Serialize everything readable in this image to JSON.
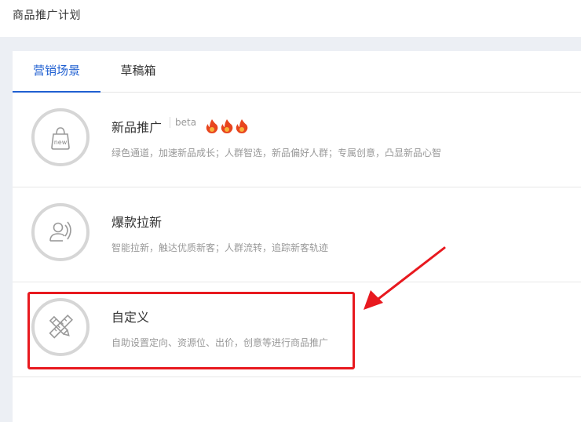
{
  "header": {
    "title": "商品推广计划"
  },
  "tabs": [
    {
      "label": "营销场景",
      "active": true
    },
    {
      "label": "草稿箱",
      "active": false
    }
  ],
  "scenes": [
    {
      "icon": "new-bag-icon",
      "name": "新品推广",
      "badge": "beta",
      "hot_count": 3,
      "hot_icon": "fire-icon",
      "description": "绿色通道，加速新品成长；人群智选，新品偏好人群；专属创意，凸显新品心智"
    },
    {
      "icon": "user-new-icon",
      "name": "爆款拉新",
      "description": "智能拉新，触达优质新客；人群流转，追踪新客轨迹"
    },
    {
      "icon": "pencil-ruler-icon",
      "name": "自定义",
      "description": "自助设置定向、资源位、出价，创意等进行商品推广",
      "highlighted": true
    }
  ],
  "colors": {
    "accent": "#1f5fd1",
    "highlight": "#e8191f",
    "fire": "#e8451e"
  },
  "icon_new_text": "new"
}
